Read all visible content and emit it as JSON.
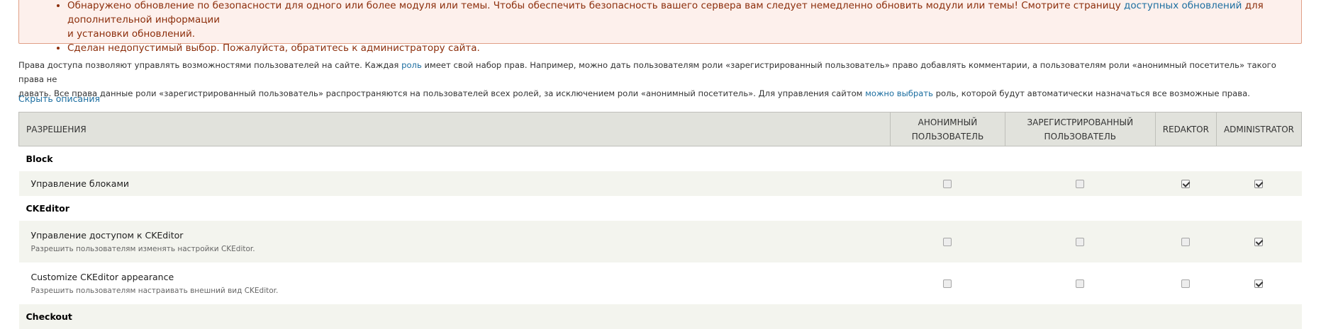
{
  "messages": {
    "item1_line1": "Обнаружено обновление по безопасности для одного или более модуля или темы. Чтобы обеспечить безопасность вашего сервера вам следует немедленно обновить модули или темы! Смотрите страницу",
    "item1_link": "доступных обновлений",
    "item1_rest": "для дополнительной информации",
    "item1_line2": "и установки обновлений.",
    "item2": "Сделан недопустимый выбор. Пожалуйста, обратитесь к администратору сайта."
  },
  "intro": {
    "p1": "Права доступа позволяют управлять возможностями пользователей на сайте. Каждая",
    "link1": "роль",
    "p2": "имеет свой набор прав. Например, можно дать пользователям роли «зарегистрированный пользователь» право добавлять комментарии, а пользователям роли «анонимный посетитель» такого права не",
    "p3": "давать. Все права данные роли «зарегистрированный пользователь» распространяются на пользователей всех ролей, за исключением роли «анонимный посетитель». Для управления сайтом",
    "link2": "можно выбрать",
    "p4": "роль, которой будут автоматически назначаться все возможные права."
  },
  "toggle_label": "Скрыть описания",
  "table": {
    "permission_header": "Разрешения",
    "role_anon_line1": "Анонимный",
    "role_anon_line2": "пользователь",
    "role_auth_line1": "Зарегистрированный",
    "role_auth_line2": "пользователь",
    "role_redaktor": "Redaktor",
    "role_admin": "Administrator",
    "modules": [
      {
        "name": "Block",
        "permissions": [
          {
            "title": "Управление блоками",
            "description": "",
            "checked": [
              false,
              false,
              true,
              true
            ]
          }
        ]
      },
      {
        "name": "CKEditor",
        "permissions": [
          {
            "title": "Управление доступом к CKEditor",
            "description": "Разрешить пользователям изменять настройки CKEditor.",
            "checked": [
              false,
              false,
              false,
              true
            ]
          },
          {
            "title": "Customize CKEditor appearance",
            "description": "Разрешить пользователям настраивать внешний вид CKEditor.",
            "checked": [
              false,
              false,
              false,
              true
            ]
          }
        ]
      },
      {
        "name": "Checkout",
        "permissions": []
      }
    ]
  }
}
